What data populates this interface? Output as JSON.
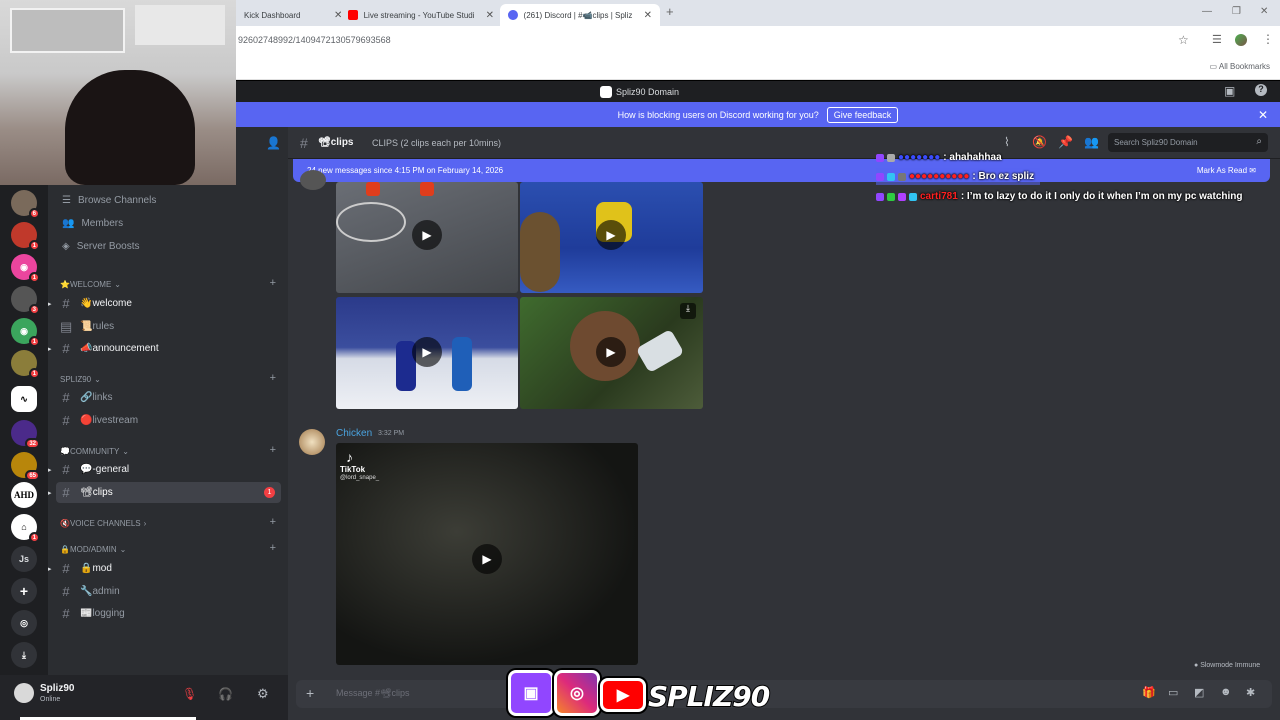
{
  "browser": {
    "tabs": [
      {
        "title": "Kick Dashboard",
        "icon": "kick-icon"
      },
      {
        "title": "Live streaming - YouTube Studio",
        "icon": "youtube-icon"
      },
      {
        "title": "(261) Discord | #📹clips | Spliz9",
        "icon": "discord-icon"
      }
    ],
    "url": "92602748992/1409472130579693568",
    "bookmarks_label": "All Bookmarks"
  },
  "discord": {
    "server_name": "Spliz90 Domain",
    "notice_text": "How is blocking users on Discord working for you?",
    "notice_button": "Give feedback",
    "nav": {
      "browse": "Browse Channels",
      "members": "Members",
      "boosts": "Server Boosts"
    },
    "categories": {
      "welcome": "⭐WELCOME",
      "spliz90": "SPLIZ90",
      "community": "💭COMMUNITY",
      "voice": "🔇Voice Channels",
      "mod": "🔒MOD/ADMIN"
    },
    "channels": {
      "welcome": "👋welcome",
      "rules": "📜rules",
      "announcement": "📣announcement",
      "links": "🔗links",
      "livestream": "🔴livestream",
      "general": "💬-general",
      "clips": "📽clips",
      "mod": "🔒mod",
      "admin": "🔧admin",
      "logging": "📰logging"
    },
    "clips_badge": "1",
    "guild_badges": [
      "6",
      "1",
      "1",
      "3",
      "1",
      "1",
      "32",
      "65",
      "1"
    ],
    "guild_letters": {
      "ahd": "AHD",
      "js": "Js"
    },
    "header": {
      "channel": "📽clips",
      "topic": "CLIPS (2 clips each per 10mins)",
      "search_placeholder": "Search Spliz90 Domain"
    },
    "new_messages": "24 new messages since 4:15 PM on February 14, 2026",
    "mark_as_read": "Mark As Read",
    "message": {
      "author": "Chicken",
      "time": "3:32 PM",
      "tiktok_label": "TikTok",
      "tiktok_handle": "@lord_snape_"
    },
    "slowmode": "Slowmode Immune",
    "composer_placeholder": "Message #📽clips",
    "user": {
      "name": "Spliz90",
      "status": "Online"
    }
  },
  "chat": [
    {
      "user": "●●●●●●●",
      "text": ": ahahahhaa",
      "color": "#3a4cff"
    },
    {
      "user": "●●●●●●●●●●",
      "text": ": Bro ez spliz",
      "color": "#ff2020"
    },
    {
      "user": "carti781",
      "text": ": I’m to lazy to do it I only do it when I’m on my pc watching",
      "color": "#ff2020"
    }
  ],
  "overlay": {
    "brand": "SPLIZ90"
  },
  "colors": {
    "blurple": "#5865f2",
    "sidebar": "#2b2d31",
    "main": "#313338",
    "guilds": "#1e1f22"
  }
}
